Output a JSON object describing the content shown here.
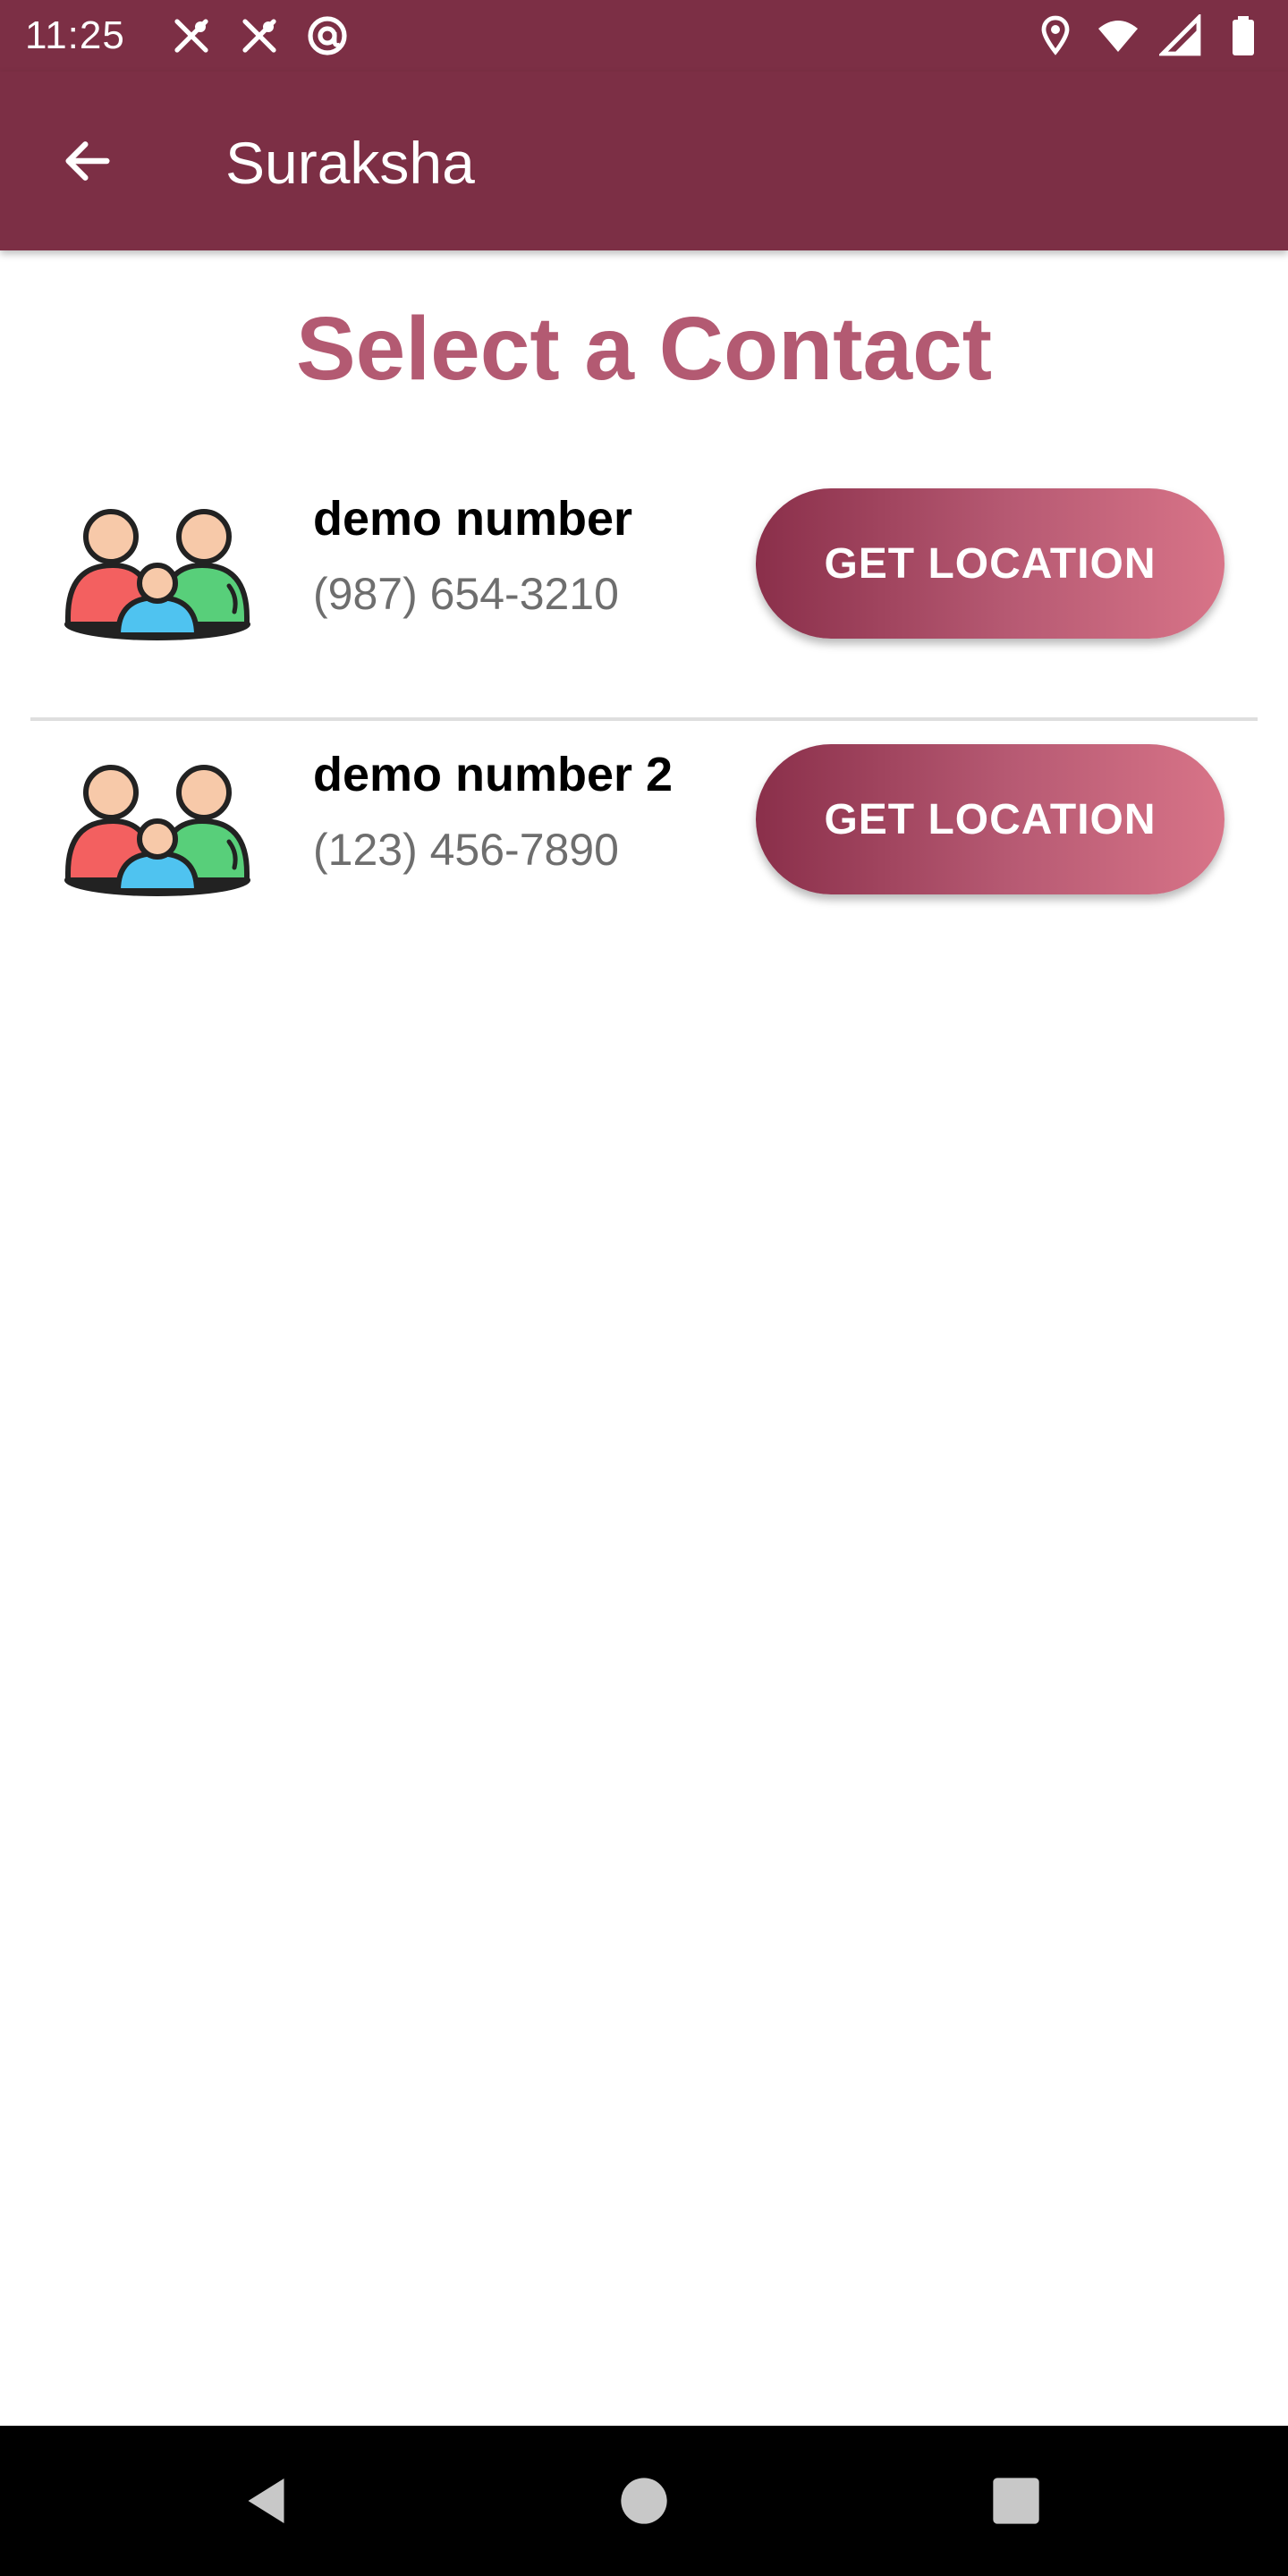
{
  "status_bar": {
    "time": "11:25",
    "left_icons": [
      "cutlery-icon",
      "cutlery-icon",
      "at-sign-icon"
    ],
    "right_icons": [
      "location-pin-icon",
      "wifi-icon",
      "signal-icon",
      "battery-icon"
    ]
  },
  "app_bar": {
    "title": "Suraksha",
    "back_icon": "arrow-left-icon"
  },
  "page": {
    "title": "Select a Contact"
  },
  "contacts": [
    {
      "name": "demo number",
      "phone": "(987) 654-3210",
      "button_label": "GET LOCATION"
    },
    {
      "name": "demo number 2",
      "phone": "(123) 456-7890",
      "button_label": "GET LOCATION"
    }
  ],
  "colors": {
    "primary": "#7c2f45",
    "title": "#b35a72",
    "button_gradient_start": "#8a2f4a",
    "button_gradient_end": "#d87488"
  },
  "nav_bar": {
    "icons": [
      "back-triangle-icon",
      "home-circle-icon",
      "recents-square-icon"
    ]
  }
}
